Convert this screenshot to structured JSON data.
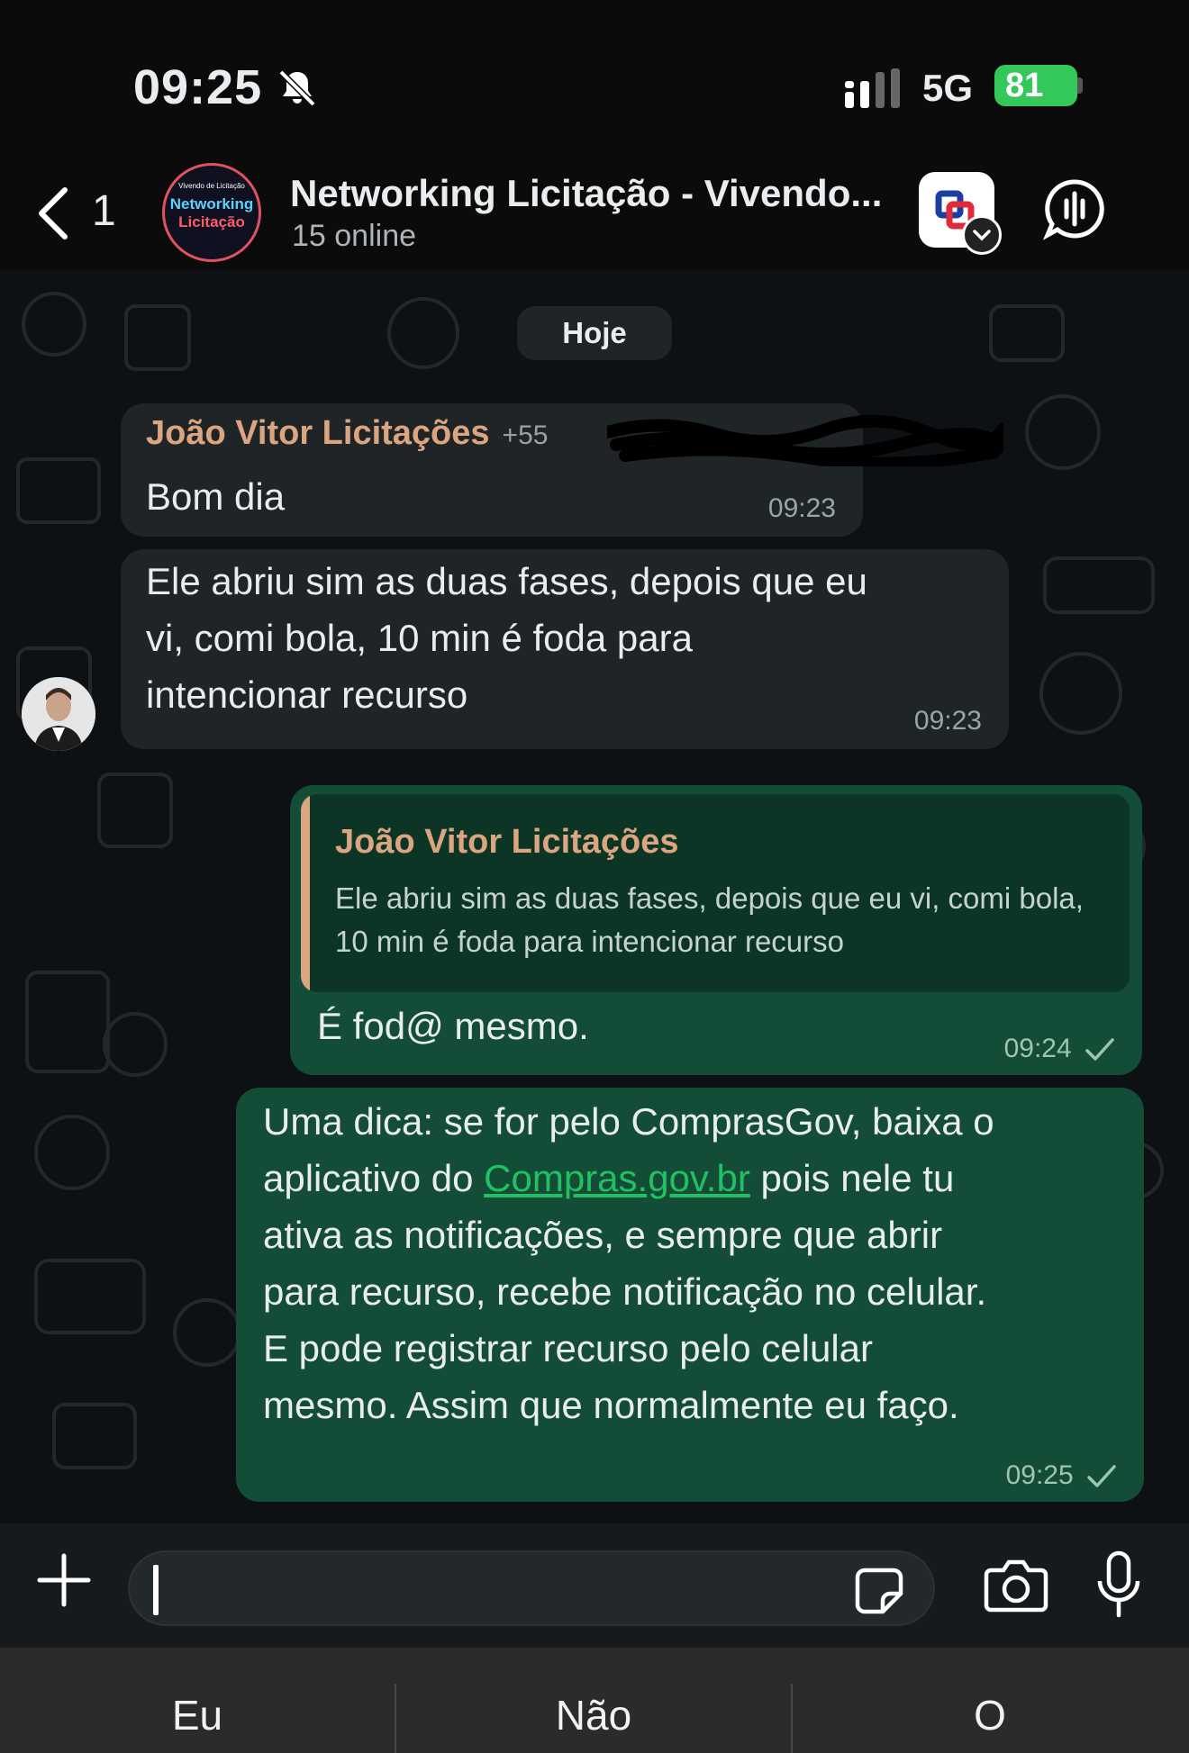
{
  "status_bar": {
    "time": "09:25",
    "network": "5G",
    "battery": "81"
  },
  "header": {
    "back_count": "1",
    "title": "Networking Licitação - Vivendo...",
    "subtitle": "15 online",
    "group_avatar": {
      "top": "Vivendo de Licitação",
      "line1": "Networking",
      "line2": "Licitação"
    },
    "icons": [
      "back-chevron-icon",
      "compras-app-icon",
      "voice-call-icon"
    ]
  },
  "chat": {
    "date_chip": "Hoje",
    "messages": [
      {
        "direction": "in",
        "sender": "João Vitor Licitações",
        "phone": "+55",
        "text": "Bom dia",
        "time": "09:23"
      },
      {
        "direction": "in",
        "text_lines": [
          "Ele abriu sim as duas fases, depois que eu",
          "vi, comi bola, 10 min é foda para",
          "intencionar recurso"
        ],
        "time": "09:23"
      },
      {
        "direction": "out",
        "quote": {
          "sender": "João Vitor Licitações",
          "text": "Ele abriu sim as duas fases, depois que eu vi, comi bola, 10 min é foda para intencionar recurso"
        },
        "text": "É fod@ mesmo.",
        "time": "09:24"
      },
      {
        "direction": "out",
        "line1": "Uma dica: se for pelo ComprasGov, baixa o",
        "line2_pre": "aplicativo do ",
        "link": "Compras.gov.br",
        "line2_post": " pois nele tu",
        "line3": "ativa as notificações, e sempre que abrir",
        "line4": "para recurso, recebe notificação no celular.",
        "line5": "E pode registrar recurso pelo celular",
        "line6": "mesmo. Assim que normalmente eu faço.",
        "time": "09:25"
      }
    ]
  },
  "input_bar": {
    "icons": [
      "plus-icon",
      "sticker-icon",
      "camera-icon",
      "microphone-icon"
    ]
  },
  "keyboard_suggestions": [
    "Eu",
    "Não",
    "O"
  ],
  "colors": {
    "outgoing_bubble": "#134d37",
    "incoming_bubble": "#1f2427",
    "sender_name": "#dba67f",
    "link": "#21c063",
    "battery": "#34c759"
  }
}
